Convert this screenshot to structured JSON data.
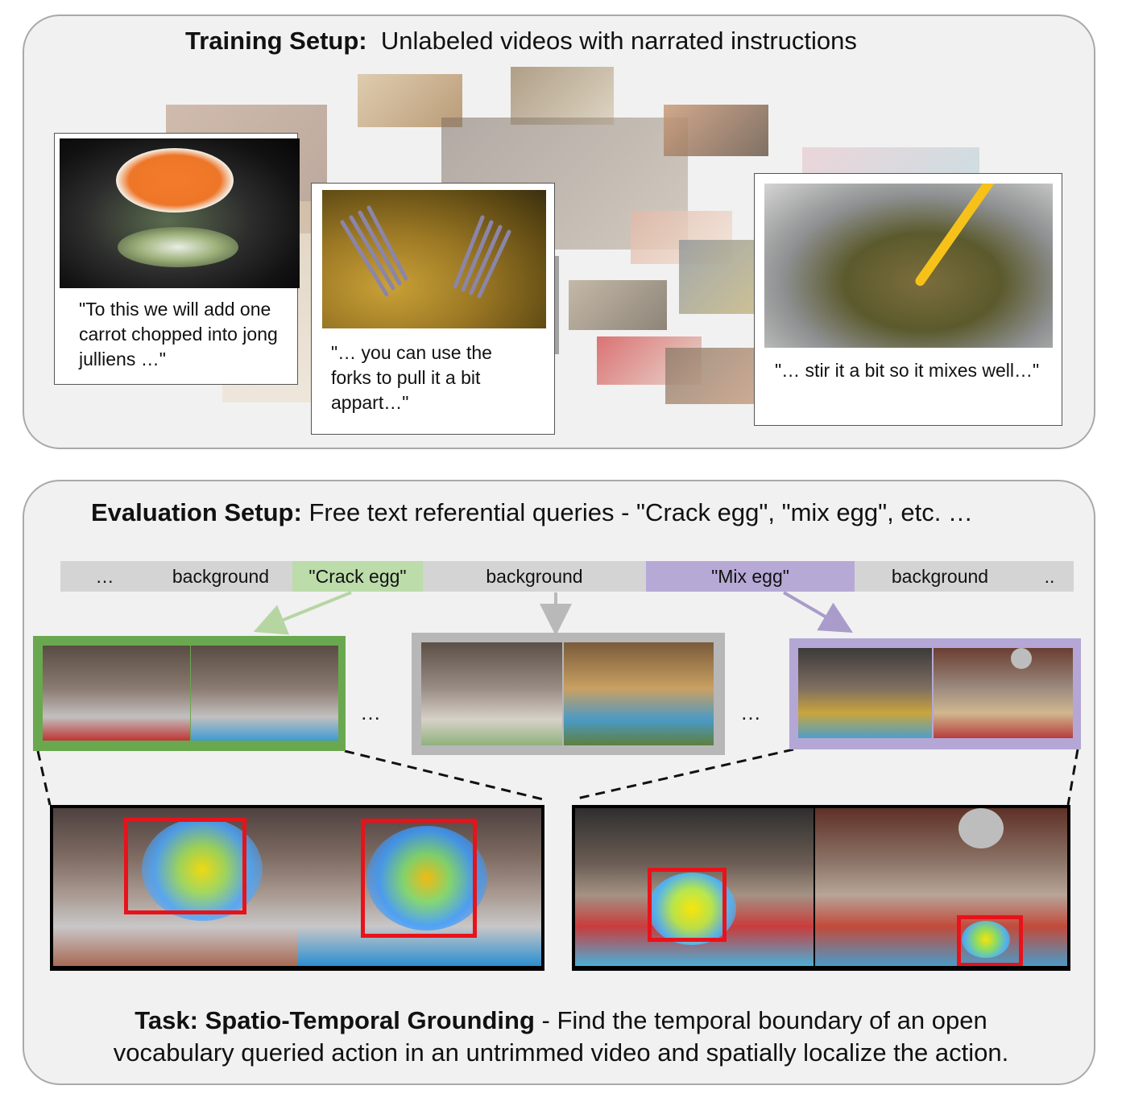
{
  "training": {
    "label": "Training Setup:",
    "text": "Unlabeled videos with narrated instructions",
    "quotes": [
      "\"To this we will add one carrot chopped into jong julliens …\"",
      "\"… you can use the forks to pull it a bit appart…\"",
      "\"… stir it a bit so it mixes well…\""
    ]
  },
  "evaluation": {
    "label": "Evaluation Setup:",
    "text": "Free text referential queries - \"Crack egg\", \"mix egg\", etc. …",
    "timeline": [
      {
        "label": "…",
        "color": "#d4d4d4"
      },
      {
        "label": "background",
        "color": "#d4d4d4"
      },
      {
        "label": "\"Crack egg\"",
        "color": "#bcdcaa"
      },
      {
        "label": "background",
        "color": "#d4d4d4"
      },
      {
        "label": "\"Mix egg\"",
        "color": "#b7a9d6"
      },
      {
        "label": "background",
        "color": "#d4d4d4"
      },
      {
        "label": "..",
        "color": "#d4d4d4"
      }
    ],
    "gap_ellipsis": "…",
    "colors": {
      "crack": "#6aa84f",
      "background": "#b7b7b7",
      "mix": "#b4a7d6",
      "bbox": "#e8121b"
    }
  },
  "task": {
    "label": "Task: Spatio-Temporal Grounding",
    "text": " - Find the temporal boundary of an open vocabulary queried action in an untrimmed video and spatially localize the action."
  }
}
